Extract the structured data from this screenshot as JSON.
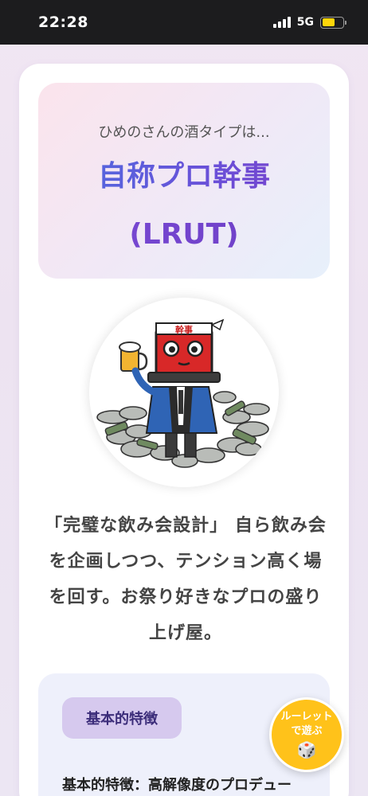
{
  "status_bar": {
    "time": "22:28",
    "network": "5G",
    "battery_level": 0.62,
    "icons": [
      "signal-icon",
      "battery-icon"
    ]
  },
  "result": {
    "intro": "ひめのさんの酒タイプは...",
    "type_name": "自称プロ幹事",
    "type_code": "(LRUT)",
    "headband_text": "幹事"
  },
  "description": "「完璧な飲み会設計」 自ら飲み会を企画しつつ、テンション高く場を回す。お祭り好きなプロの盛り上げ屋。",
  "section": {
    "tag_label": "基本的特徴",
    "heading": "基本的特徴：高解像度のプロデュー"
  },
  "roulette_button": {
    "label": "ルーレットで遊ぶ",
    "icon": "🎲"
  },
  "colors": {
    "accent_blue": "#4d6fe0",
    "accent_purple": "#7b3fc8",
    "roulette": "#ffc21a"
  }
}
